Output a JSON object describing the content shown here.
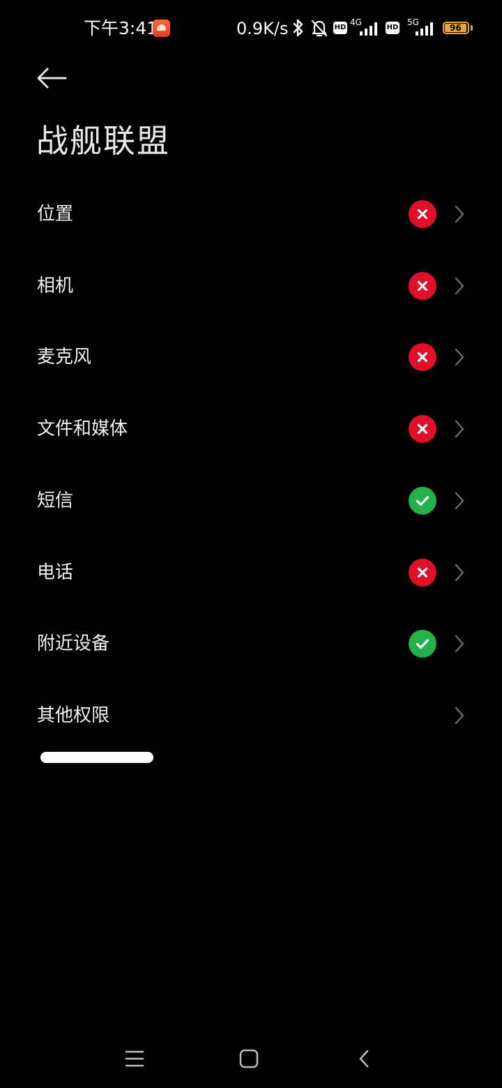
{
  "status_bar": {
    "time": "下午3:41",
    "net_speed": "0.9K/s",
    "hd_label": "HD",
    "network_1": "4G",
    "network_2": "5G",
    "battery_level": "96",
    "battery_fraction": 0.96,
    "icons": [
      "app-notification-icon",
      "bluetooth-icon",
      "mute-icon",
      "signal-icon",
      "battery-icon"
    ]
  },
  "header": {
    "back_icon": "arrow-left-icon",
    "title": "战舰联盟"
  },
  "permissions": [
    {
      "label": "位置",
      "status": "denied"
    },
    {
      "label": "相机",
      "status": "denied"
    },
    {
      "label": "麦克风",
      "status": "denied"
    },
    {
      "label": "文件和媒体",
      "status": "denied"
    },
    {
      "label": "短信",
      "status": "allowed"
    },
    {
      "label": "电话",
      "status": "denied"
    },
    {
      "label": "附近设备",
      "status": "allowed"
    },
    {
      "label": "其他权限",
      "status": "none"
    }
  ],
  "colors": {
    "denied": "#e0102a",
    "allowed": "#22b14c",
    "chevron": "#6e6e6e",
    "battery": "#e8a33c"
  },
  "nav_bar": {
    "icons": [
      "menu-icon",
      "home-icon",
      "back-icon"
    ]
  }
}
